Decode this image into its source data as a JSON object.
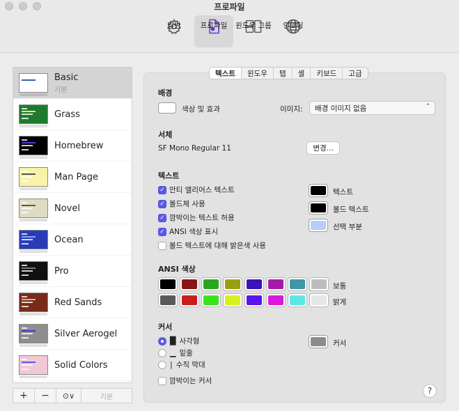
{
  "window": {
    "title": "프로파일"
  },
  "toolbar": {
    "tabs": [
      {
        "label": "일반",
        "icon": "gear-icon"
      },
      {
        "label": "프로파일",
        "icon": "profile-document-icon",
        "active": true
      },
      {
        "label": "윈도우 그룹",
        "icon": "window-groups-icon"
      },
      {
        "label": "인코딩",
        "icon": "globe-icon"
      }
    ]
  },
  "sidebar": {
    "profiles": [
      {
        "name": "Basic",
        "sub": "기본",
        "bg": "#ffffff",
        "accent": "#3a5ea8",
        "selected": true
      },
      {
        "name": "Grass",
        "bg": "#1e7a2e",
        "accent": "#f5e07a"
      },
      {
        "name": "Homebrew",
        "bg": "#000000",
        "accent": "#4a3bd8"
      },
      {
        "name": "Man Page",
        "bg": "#f7f3a8",
        "accent": "#555555"
      },
      {
        "name": "Novel",
        "bg": "#dfdbc3",
        "accent": "#6b5b3a"
      },
      {
        "name": "Ocean",
        "bg": "#2a3bb8",
        "accent": "#8fa3ff"
      },
      {
        "name": "Pro",
        "bg": "#111111",
        "accent": "#7a7a7a"
      },
      {
        "name": "Red Sands",
        "bg": "#7a2a1a",
        "accent": "#d8b088"
      },
      {
        "name": "Silver Aerogel",
        "bg": "#8e8e8e",
        "accent": "#3b3bd0"
      },
      {
        "name": "Solid Colors",
        "bg": "#f0c8d8",
        "accent": "#5a5ae6"
      }
    ],
    "buttons": {
      "add": "+",
      "remove": "−",
      "more": "⊙∨",
      "default": "기본"
    }
  },
  "panel": {
    "subtabs": [
      "텍스트",
      "윈도우",
      "탭",
      "셸",
      "키보드",
      "고급"
    ],
    "background": {
      "title": "배경",
      "color_label": "색상 및 효과",
      "image_label": "이미지:",
      "image_value": "배경 이미지 없음"
    },
    "font": {
      "title": "서체",
      "value": "SF Mono Regular 11",
      "change_button": "변경..."
    },
    "text": {
      "title": "텍스트",
      "checkboxes": [
        {
          "label": "안티 앨리어스 텍스트",
          "checked": true
        },
        {
          "label": "볼드체 사용",
          "checked": true
        },
        {
          "label": "깜박이는 텍스트 허용",
          "checked": true
        },
        {
          "label": "ANSI 색상 표시",
          "checked": true
        },
        {
          "label": "볼드 텍스트에 대해 밝은색 사용",
          "checked": false
        }
      ],
      "colors": [
        {
          "label": "텍스트",
          "color": "#000000"
        },
        {
          "label": "볼드 텍스트",
          "color": "#000000"
        },
        {
          "label": "선택 부분",
          "color": "#b6cdff"
        }
      ]
    },
    "ansi": {
      "title": "ANSI 색상",
      "normal_label": "보통",
      "bright_label": "밝게",
      "normal": [
        "#000000",
        "#8b1414",
        "#2aa61a",
        "#9a9e10",
        "#3a14b8",
        "#a818a8",
        "#3f98a8",
        "#bdbdbd"
      ],
      "bright": [
        "#5a5a5a",
        "#c91e1e",
        "#38e31c",
        "#d6f01c",
        "#5a14f0",
        "#dc18dc",
        "#5ce6e6",
        "#e6e6e6"
      ]
    },
    "cursor": {
      "title": "커서",
      "options": [
        {
          "label": "사각형",
          "glyph": "█",
          "selected": true
        },
        {
          "label": "밑줄",
          "glyph": "▁",
          "selected": false
        },
        {
          "label": "수직 막대",
          "glyph": "|",
          "selected": false
        }
      ],
      "blink_label": "깜박이는 커서",
      "blink_checked": false,
      "color_label": "커서",
      "color": "#8c8c8c"
    },
    "help": "?"
  }
}
